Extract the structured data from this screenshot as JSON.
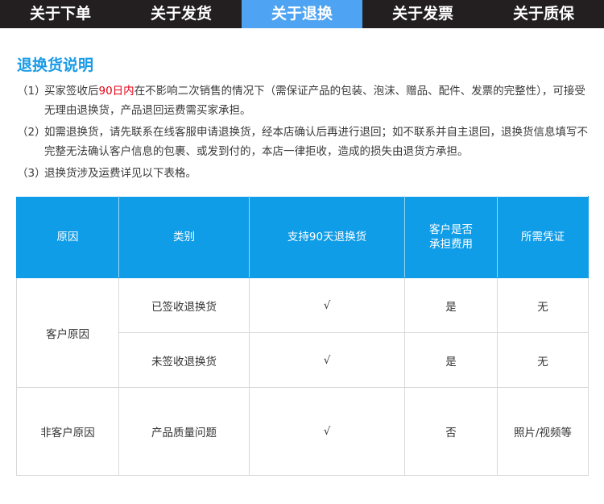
{
  "nav": {
    "tabs": [
      {
        "label": "关于下单"
      },
      {
        "label": "关于发货"
      },
      {
        "label": "关于退换"
      },
      {
        "label": "关于发票"
      },
      {
        "label": "关于质保"
      }
    ],
    "active_tab": "关于退换"
  },
  "section": {
    "title": "退换货说明",
    "notes": [
      {
        "num": "（1）",
        "pre": "买家签收后",
        "highlight": "90日内",
        "post": "在不影响二次销售的情况下（需保证产品的包装、泡沫、赠品、配件、发票的完整性），可接受无理由退换货，产品退回运费需买家承担。"
      },
      {
        "num": "（2）",
        "text": "如需退换货，请先联系在线客服申请退换货，经本店确认后再进行退回；如不联系并自主退回，退换货信息填写不完整无法确认客户信息的包裹、或发到付的，本店一律拒收，造成的损失由退货方承担。"
      },
      {
        "num": "（3）",
        "text": "退换货涉及运费详见以下表格。"
      }
    ]
  },
  "table": {
    "headers": [
      "原因",
      "类别",
      "支持90天退换货",
      "客户是否",
      "承担费用",
      "所需凭证"
    ],
    "rows": [
      {
        "reason": "客户原因",
        "category": "已签收退换货",
        "support": "√",
        "pay": "是",
        "proof": "无"
      },
      {
        "category": "未签收退换货",
        "support": "√",
        "pay": "是",
        "proof": "无"
      },
      {
        "reason": "非客户原因",
        "category": "产品质量问题",
        "support": "√",
        "pay": "否",
        "proof": "照片/视频等"
      }
    ]
  },
  "colors": {
    "nav_bg": "#231f20",
    "nav_active": "#4ea4f2",
    "title": "#1a9be8",
    "highlight": "#e60012",
    "table_header": "#109de8",
    "border": "#d9d9d9"
  }
}
